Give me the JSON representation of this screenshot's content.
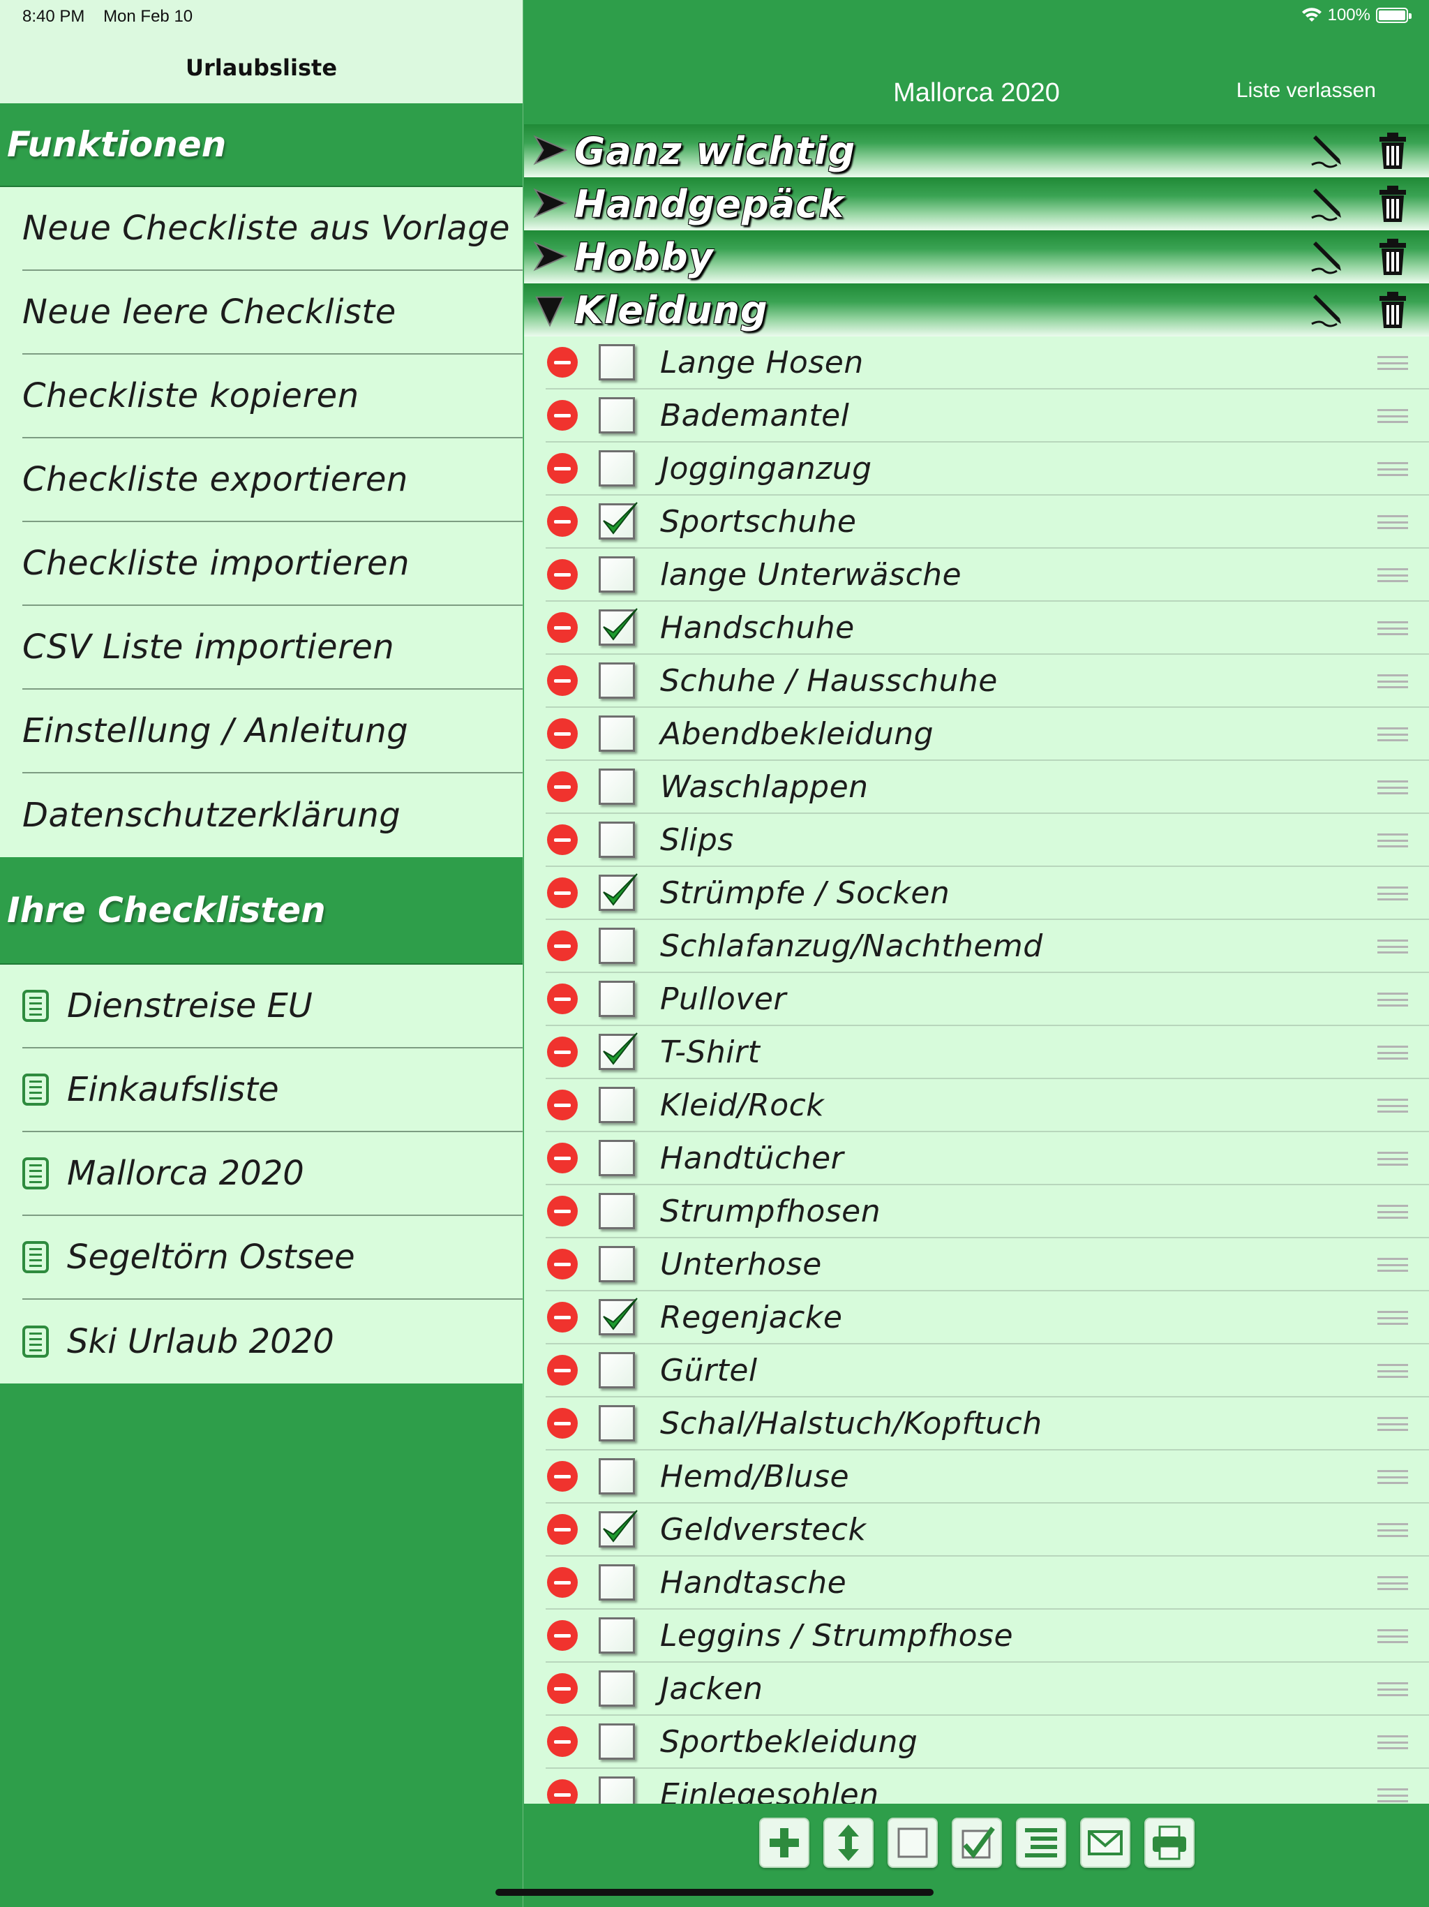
{
  "status": {
    "time": "8:40 PM",
    "date": "Mon Feb 10",
    "battery": "100%"
  },
  "sidebar": {
    "title": "Urlaubsliste",
    "functions_header": "Funktionen",
    "functions": [
      "Neue Checkliste aus Vorlage",
      "Neue leere Checkliste",
      "Checkliste kopieren",
      "Checkliste exportieren",
      "Checkliste importieren",
      "CSV Liste importieren",
      "Einstellung / Anleitung",
      "Datenschutzerklärung"
    ],
    "checklists_header": "Ihre Checklisten",
    "checklists": [
      "Dienstreise EU",
      "Einkaufsliste",
      "Mallorca 2020",
      "Segeltörn Ostsee",
      "Ski Urlaub 2020"
    ]
  },
  "main": {
    "title": "Mallorca 2020",
    "leave_label": "Liste verlassen",
    "categories": [
      {
        "label": "Ganz wichtig",
        "expanded": false
      },
      {
        "label": "Handgepäck",
        "expanded": false
      },
      {
        "label": "Hobby",
        "expanded": false
      },
      {
        "label": "Kleidung",
        "expanded": true
      }
    ],
    "items": [
      {
        "label": "Lange Hosen",
        "checked": false
      },
      {
        "label": "Bademantel",
        "checked": false
      },
      {
        "label": "Jogginganzug",
        "checked": false
      },
      {
        "label": "Sportschuhe",
        "checked": true
      },
      {
        "label": "lange Unterwäsche",
        "checked": false
      },
      {
        "label": "Handschuhe",
        "checked": true
      },
      {
        "label": "Schuhe / Hausschuhe",
        "checked": false
      },
      {
        "label": "Abendbekleidung",
        "checked": false
      },
      {
        "label": "Waschlappen",
        "checked": false
      },
      {
        "label": "Slips",
        "checked": false
      },
      {
        "label": "Strümpfe / Socken",
        "checked": true
      },
      {
        "label": "Schlafanzug/Nachthemd",
        "checked": false
      },
      {
        "label": "Pullover",
        "checked": false
      },
      {
        "label": "T-Shirt",
        "checked": true
      },
      {
        "label": "Kleid/Rock",
        "checked": false
      },
      {
        "label": "Handtücher",
        "checked": false
      },
      {
        "label": "Strumpfhosen",
        "checked": false
      },
      {
        "label": "Unterhose",
        "checked": false
      },
      {
        "label": "Regenjacke",
        "checked": true
      },
      {
        "label": "Gürtel",
        "checked": false
      },
      {
        "label": "Schal/Halstuch/Kopftuch",
        "checked": false
      },
      {
        "label": "Hemd/Bluse",
        "checked": false
      },
      {
        "label": "Geldversteck",
        "checked": true
      },
      {
        "label": "Handtasche",
        "checked": false
      },
      {
        "label": "Leggins / Strumpfhose",
        "checked": false
      },
      {
        "label": "Jacken",
        "checked": false
      },
      {
        "label": "Sportbekleidung",
        "checked": false
      },
      {
        "label": "Einlegesohlen",
        "checked": false
      }
    ],
    "toolbar": [
      "add-icon",
      "sort-icon",
      "uncheck-all-icon",
      "check-all-icon",
      "list-icon",
      "mail-icon",
      "print-icon"
    ]
  },
  "colors": {
    "brand_green": "#2e9e4a",
    "list_bg": "#d7fbdb",
    "delete_red": "#f0332e"
  }
}
